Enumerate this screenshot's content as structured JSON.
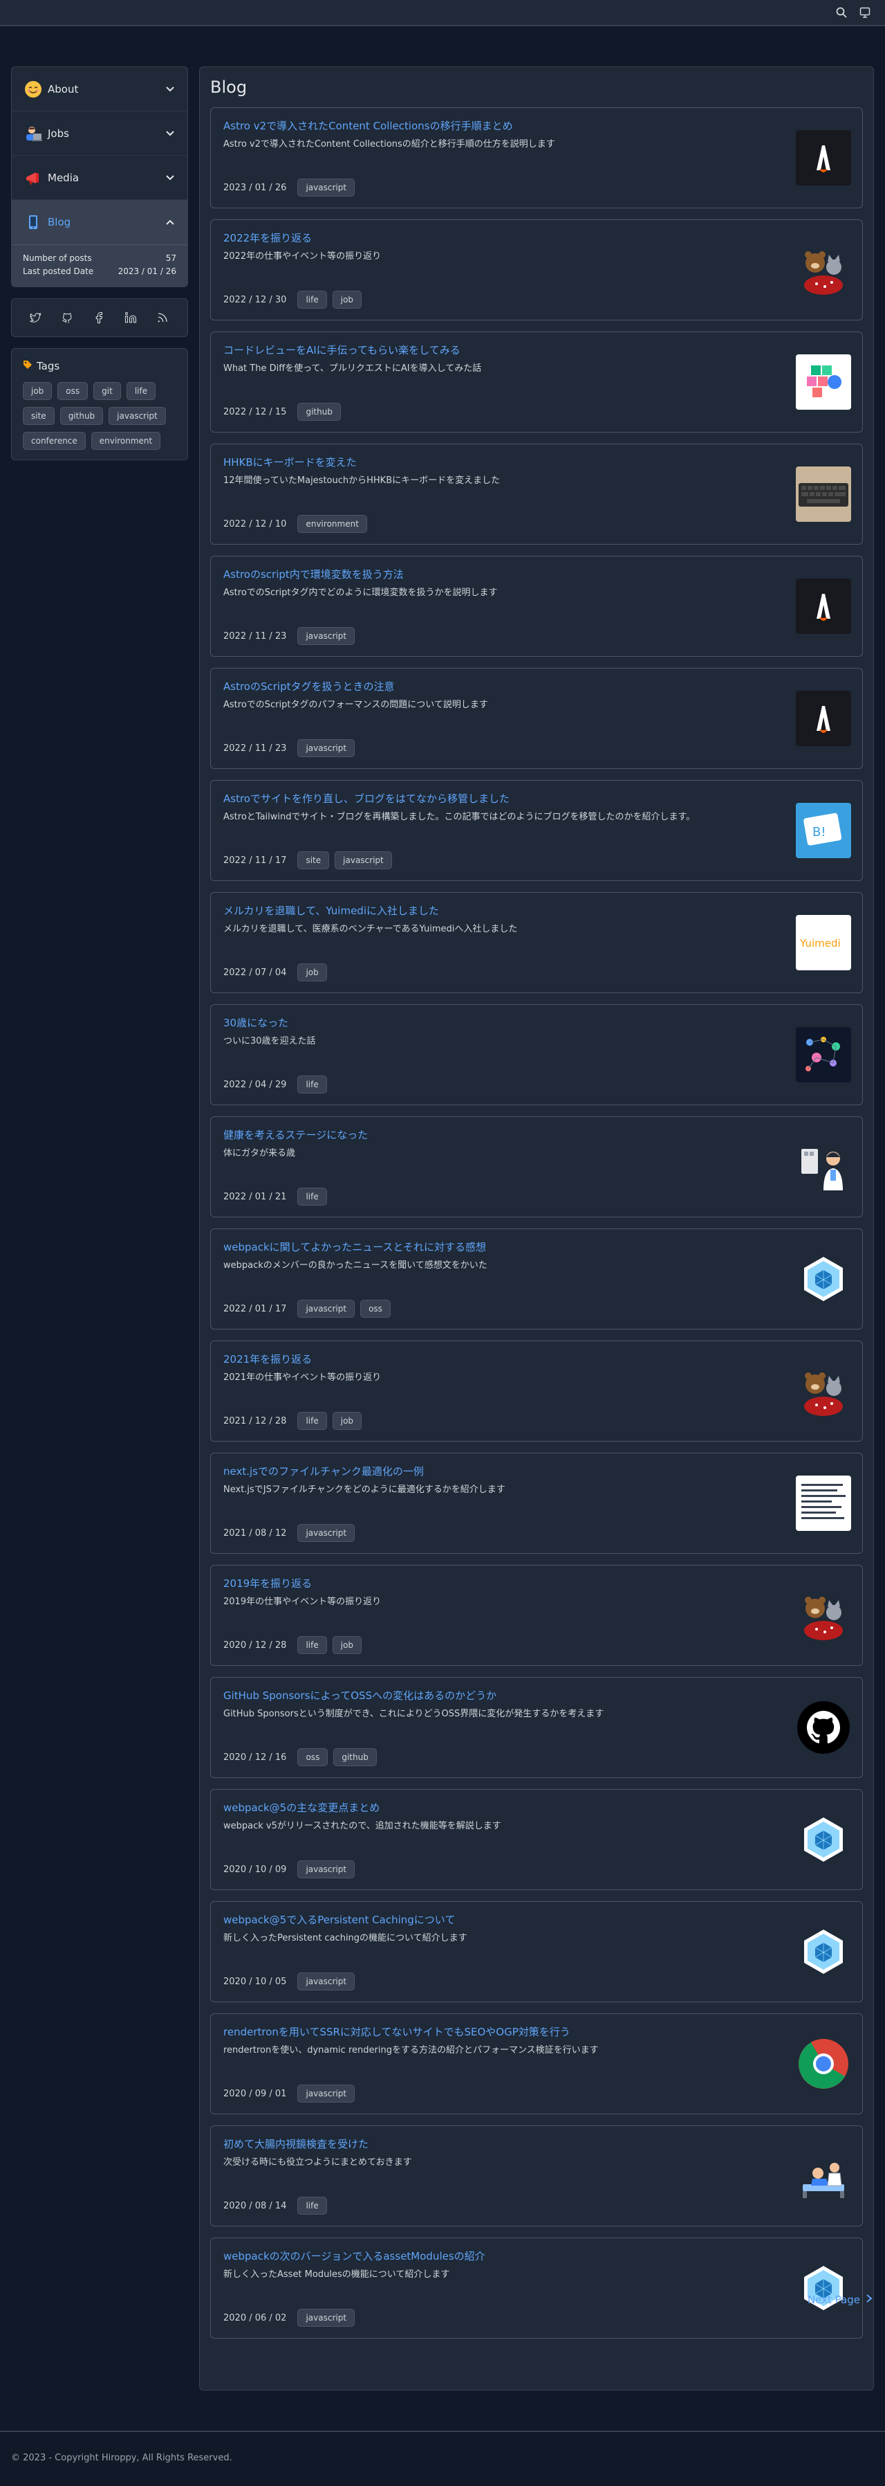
{
  "sidebar": {
    "menu": [
      {
        "label": "About",
        "icon": "smiling-face-icon"
      },
      {
        "label": "Jobs",
        "icon": "technologist-icon"
      },
      {
        "label": "Media",
        "icon": "megaphone-icon"
      },
      {
        "label": "Blog",
        "icon": "mobile-phone-icon"
      }
    ],
    "blog_stats": {
      "posts_label": "Number of posts",
      "posts_value": "57",
      "last_label": "Last posted Date",
      "last_value": "2023 / 01 / 26"
    },
    "tags_title": "Tags",
    "tags": [
      "job",
      "oss",
      "git",
      "life",
      "site",
      "github",
      "javascript",
      "conference",
      "environment"
    ]
  },
  "main": {
    "title": "Blog",
    "posts": [
      {
        "title": "Astro v2で導入されたContent Collectionsの移行手順まとめ",
        "desc": "Astro v2で導入されたContent Collectionsの紹介と移行手順の仕方を説明します",
        "date": "2023 / 01 / 26",
        "tags": [
          "javascript"
        ],
        "thumb": "astro"
      },
      {
        "title": "2022年を振り返る",
        "desc": "2022年の仕事やイベント等の振り返り",
        "date": "2022 / 12 / 30",
        "tags": [
          "life",
          "job"
        ],
        "thumb": "bear-cat"
      },
      {
        "title": "コードレビューをAIに手伝ってもらい楽をしてみる",
        "desc": "What The Diffを使って、プルリクエストにAIを導入してみた話",
        "date": "2022 / 12 / 15",
        "tags": [
          "github"
        ],
        "thumb": "blocks"
      },
      {
        "title": "HHKBにキーボードを変えた",
        "desc": "12年間使っていたMajestouchからHHKBにキーボードを変えました",
        "date": "2022 / 12 / 10",
        "tags": [
          "environment"
        ],
        "thumb": "keyboard"
      },
      {
        "title": "Astroのscript内で環境変数を扱う方法",
        "desc": "AstroでのScriptタグ内でどのように環境変数を扱うかを説明します",
        "date": "2022 / 11 / 23",
        "tags": [
          "javascript"
        ],
        "thumb": "astro"
      },
      {
        "title": "AstroのScriptタグを扱うときの注意",
        "desc": "AstroでのScriptタグのパフォーマンスの問題について説明します",
        "date": "2022 / 11 / 23",
        "tags": [
          "javascript"
        ],
        "thumb": "astro"
      },
      {
        "title": "Astroでサイトを作り直し、ブログをはてなから移管しました",
        "desc": "AstroとTailwindでサイト・ブログを再構築しました。この記事ではどのようにブログを移管したのかを紹介します。",
        "date": "2022 / 11 / 17",
        "tags": [
          "site",
          "javascript"
        ],
        "thumb": "hatena"
      },
      {
        "title": "メルカリを退職して、Yuimediに入社しました",
        "desc": "メルカリを退職して、医療系のベンチャーであるYuimediへ入社しました",
        "date": "2022 / 07 / 04",
        "tags": [
          "job"
        ],
        "thumb": "yuimedi"
      },
      {
        "title": "30歳になった",
        "desc": "ついに30歳を迎えた話",
        "date": "2022 / 04 / 29",
        "tags": [
          "life"
        ],
        "thumb": "map"
      },
      {
        "title": "健康を考えるステージになった",
        "desc": "体にガタが来る歳",
        "date": "2022 / 01 / 21",
        "tags": [
          "life"
        ],
        "thumb": "doctor"
      },
      {
        "title": "webpackに関してよかったニュースとそれに対する感想",
        "desc": "webpackのメンバーの良かったニュースを聞いて感想文をかいた",
        "date": "2022 / 01 / 17",
        "tags": [
          "javascript",
          "oss"
        ],
        "thumb": "webpack"
      },
      {
        "title": "2021年を振り返る",
        "desc": "2021年の仕事やイベント等の振り返り",
        "date": "2021 / 12 / 28",
        "tags": [
          "life",
          "job"
        ],
        "thumb": "bear-cat"
      },
      {
        "title": "next.jsでのファイルチャンク最適化の一例",
        "desc": "Next.jsでJSファイルチャンクをどのように最適化するかを紹介します",
        "date": "2021 / 08 / 12",
        "tags": [
          "javascript"
        ],
        "thumb": "doc"
      },
      {
        "title": "2019年を振り返る",
        "desc": "2019年の仕事やイベント等の振り返り",
        "date": "2020 / 12 / 28",
        "tags": [
          "life",
          "job"
        ],
        "thumb": "bear-cat"
      },
      {
        "title": "GitHub SponsorsによってOSSへの変化はあるのかどうか",
        "desc": "GitHub Sponsorsという制度ができ、これによりどうOSS界隈に変化が発生するかを考えます",
        "date": "2020 / 12 / 16",
        "tags": [
          "oss",
          "github"
        ],
        "thumb": "github"
      },
      {
        "title": "webpack@5の主な変更点まとめ",
        "desc": "webpack v5がリリースされたので、追加された機能等を解説します",
        "date": "2020 / 10 / 09",
        "tags": [
          "javascript"
        ],
        "thumb": "webpack"
      },
      {
        "title": "webpack@5で入るPersistent Cachingについて",
        "desc": "新しく入ったPersistent cachingの機能について紹介します",
        "date": "2020 / 10 / 05",
        "tags": [
          "javascript"
        ],
        "thumb": "webpack"
      },
      {
        "title": "rendertronを用いてSSRに対応してないサイトでもSEOやOGP対策を行う",
        "desc": "rendertronを使い、dynamic renderingをする方法の紹介とパフォーマンス検証を行います",
        "date": "2020 / 09 / 01",
        "tags": [
          "javascript"
        ],
        "thumb": "chrome"
      },
      {
        "title": "初めて大腸内視鏡検査を受けた",
        "desc": "次受ける時にも役立つようにまとめておきます",
        "date": "2020 / 08 / 14",
        "tags": [
          "life"
        ],
        "thumb": "patient"
      },
      {
        "title": "webpackの次のバージョンで入るassetModulesの紹介",
        "desc": "新しく入ったAsset Modulesの機能について紹介します",
        "date": "2020 / 06 / 02",
        "tags": [
          "javascript"
        ],
        "thumb": "webpack"
      }
    ],
    "next_page": "Next Page"
  },
  "footer": {
    "copyright": "© 2023 - Copyright Hiroppy, All Rights Reserved."
  },
  "colors": {
    "background": "#111827",
    "card": "#1f2937",
    "accent": "#60a5fa",
    "border": "#374151"
  }
}
